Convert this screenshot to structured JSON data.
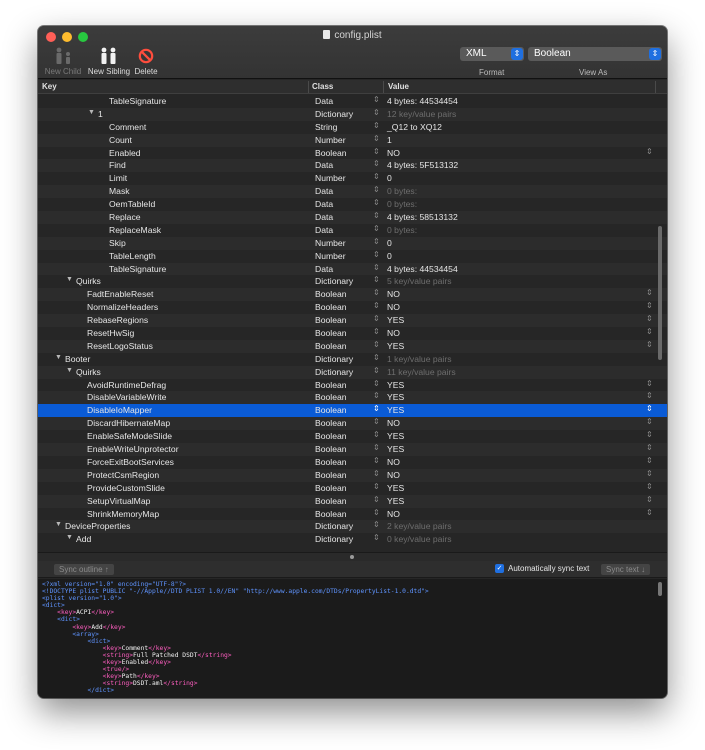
{
  "window": {
    "title": "config.plist"
  },
  "toolbar": {
    "new_child": "New Child",
    "new_sibling": "New Sibling",
    "delete": "Delete",
    "format_value": "XML",
    "format_label": "Format",
    "view_value": "Boolean",
    "view_label": "View As"
  },
  "columns": {
    "key": "Key",
    "class": "Class",
    "value": "Value"
  },
  "rows": [
    {
      "key": "TableSignature",
      "level": 5,
      "tri": "",
      "class": "Data",
      "value": "4 bytes: 44534454",
      "dim": false,
      "step": false,
      "sel": false
    },
    {
      "key": "1",
      "level": 4,
      "tri": "▼",
      "class": "Dictionary",
      "value": "12 key/value pairs",
      "dim": true,
      "step": false,
      "sel": false
    },
    {
      "key": "Comment",
      "level": 5,
      "tri": "",
      "class": "String",
      "value": "_Q12 to XQ12",
      "dim": false,
      "step": false,
      "sel": false
    },
    {
      "key": "Count",
      "level": 5,
      "tri": "",
      "class": "Number",
      "value": "1",
      "dim": false,
      "step": false,
      "sel": false
    },
    {
      "key": "Enabled",
      "level": 5,
      "tri": "",
      "class": "Boolean",
      "value": "NO",
      "dim": false,
      "step": true,
      "sel": false
    },
    {
      "key": "Find",
      "level": 5,
      "tri": "",
      "class": "Data",
      "value": "4 bytes: 5F513132",
      "dim": false,
      "step": false,
      "sel": false
    },
    {
      "key": "Limit",
      "level": 5,
      "tri": "",
      "class": "Number",
      "value": "0",
      "dim": false,
      "step": false,
      "sel": false
    },
    {
      "key": "Mask",
      "level": 5,
      "tri": "",
      "class": "Data",
      "value": "0 bytes:",
      "dim": true,
      "step": false,
      "sel": false
    },
    {
      "key": "OemTableId",
      "level": 5,
      "tri": "",
      "class": "Data",
      "value": "0 bytes:",
      "dim": true,
      "step": false,
      "sel": false
    },
    {
      "key": "Replace",
      "level": 5,
      "tri": "",
      "class": "Data",
      "value": "4 bytes: 58513132",
      "dim": false,
      "step": false,
      "sel": false
    },
    {
      "key": "ReplaceMask",
      "level": 5,
      "tri": "",
      "class": "Data",
      "value": "0 bytes:",
      "dim": true,
      "step": false,
      "sel": false
    },
    {
      "key": "Skip",
      "level": 5,
      "tri": "",
      "class": "Number",
      "value": "0",
      "dim": false,
      "step": false,
      "sel": false
    },
    {
      "key": "TableLength",
      "level": 5,
      "tri": "",
      "class": "Number",
      "value": "0",
      "dim": false,
      "step": false,
      "sel": false
    },
    {
      "key": "TableSignature",
      "level": 5,
      "tri": "",
      "class": "Data",
      "value": "4 bytes: 44534454",
      "dim": false,
      "step": false,
      "sel": false
    },
    {
      "key": "Quirks",
      "level": 2,
      "tri": "▼",
      "class": "Dictionary",
      "value": "5 key/value pairs",
      "dim": true,
      "step": false,
      "sel": false
    },
    {
      "key": "FadtEnableReset",
      "level": 3,
      "tri": "",
      "class": "Boolean",
      "value": "NO",
      "dim": false,
      "step": true,
      "sel": false
    },
    {
      "key": "NormalizeHeaders",
      "level": 3,
      "tri": "",
      "class": "Boolean",
      "value": "NO",
      "dim": false,
      "step": true,
      "sel": false
    },
    {
      "key": "RebaseRegions",
      "level": 3,
      "tri": "",
      "class": "Boolean",
      "value": "YES",
      "dim": false,
      "step": true,
      "sel": false
    },
    {
      "key": "ResetHwSig",
      "level": 3,
      "tri": "",
      "class": "Boolean",
      "value": "NO",
      "dim": false,
      "step": true,
      "sel": false
    },
    {
      "key": "ResetLogoStatus",
      "level": 3,
      "tri": "",
      "class": "Boolean",
      "value": "YES",
      "dim": false,
      "step": true,
      "sel": false
    },
    {
      "key": "Booter",
      "level": 1,
      "tri": "▼",
      "class": "Dictionary",
      "value": "1 key/value pairs",
      "dim": true,
      "step": false,
      "sel": false
    },
    {
      "key": "Quirks",
      "level": 2,
      "tri": "▼",
      "class": "Dictionary",
      "value": "11 key/value pairs",
      "dim": true,
      "step": false,
      "sel": false
    },
    {
      "key": "AvoidRuntimeDefrag",
      "level": 3,
      "tri": "",
      "class": "Boolean",
      "value": "YES",
      "dim": false,
      "step": true,
      "sel": false
    },
    {
      "key": "DisableVariableWrite",
      "level": 3,
      "tri": "",
      "class": "Boolean",
      "value": "YES",
      "dim": false,
      "step": true,
      "sel": false
    },
    {
      "key": "DisableIoMapper",
      "level": 3,
      "tri": "",
      "class": "Boolean",
      "value": "YES",
      "dim": false,
      "step": true,
      "sel": true
    },
    {
      "key": "DiscardHibernateMap",
      "level": 3,
      "tri": "",
      "class": "Boolean",
      "value": "NO",
      "dim": false,
      "step": true,
      "sel": false
    },
    {
      "key": "EnableSafeModeSlide",
      "level": 3,
      "tri": "",
      "class": "Boolean",
      "value": "YES",
      "dim": false,
      "step": true,
      "sel": false
    },
    {
      "key": "EnableWriteUnprotector",
      "level": 3,
      "tri": "",
      "class": "Boolean",
      "value": "YES",
      "dim": false,
      "step": true,
      "sel": false
    },
    {
      "key": "ForceExitBootServices",
      "level": 3,
      "tri": "",
      "class": "Boolean",
      "value": "NO",
      "dim": false,
      "step": true,
      "sel": false
    },
    {
      "key": "ProtectCsmRegion",
      "level": 3,
      "tri": "",
      "class": "Boolean",
      "value": "NO",
      "dim": false,
      "step": true,
      "sel": false
    },
    {
      "key": "ProvideCustomSlide",
      "level": 3,
      "tri": "",
      "class": "Boolean",
      "value": "YES",
      "dim": false,
      "step": true,
      "sel": false
    },
    {
      "key": "SetupVirtualMap",
      "level": 3,
      "tri": "",
      "class": "Boolean",
      "value": "YES",
      "dim": false,
      "step": true,
      "sel": false
    },
    {
      "key": "ShrinkMemoryMap",
      "level": 3,
      "tri": "",
      "class": "Boolean",
      "value": "NO",
      "dim": false,
      "step": true,
      "sel": false
    },
    {
      "key": "DeviceProperties",
      "level": 1,
      "tri": "▼",
      "class": "Dictionary",
      "value": "2 key/value pairs",
      "dim": true,
      "step": false,
      "sel": false
    },
    {
      "key": "Add",
      "level": 2,
      "tri": "▼",
      "class": "Dictionary",
      "value": "0 key/value pairs",
      "dim": true,
      "step": false,
      "sel": false
    }
  ],
  "sync": {
    "outline_button": "Sync outline ↑",
    "auto_label": "Automatically sync text",
    "text_button": "Sync text ↓"
  },
  "xml_lines": [
    [
      {
        "c": "blue",
        "t": "<?xml version=\"1.0\" encoding=\"UTF-8\"?>"
      }
    ],
    [
      {
        "c": "blue",
        "t": "<!DOCTYPE plist PUBLIC \"-//Apple//DTD PLIST 1.0//EN\" \"http://www.apple.com/DTDs/PropertyList-1.0.dtd\">"
      }
    ],
    [
      {
        "c": "blue",
        "t": "<plist version=\"1.0\">"
      }
    ],
    [
      {
        "c": "blue",
        "t": "<dict>"
      }
    ],
    [
      {
        "c": "white",
        "t": "    "
      },
      {
        "c": "pink",
        "t": "<key>"
      },
      {
        "c": "white",
        "t": "ACPI"
      },
      {
        "c": "pink",
        "t": "</key>"
      }
    ],
    [
      {
        "c": "white",
        "t": "    "
      },
      {
        "c": "blue",
        "t": "<dict>"
      }
    ],
    [
      {
        "c": "white",
        "t": "        "
      },
      {
        "c": "pink",
        "t": "<key>"
      },
      {
        "c": "white",
        "t": "Add"
      },
      {
        "c": "pink",
        "t": "</key>"
      }
    ],
    [
      {
        "c": "white",
        "t": "        "
      },
      {
        "c": "blue",
        "t": "<array>"
      }
    ],
    [
      {
        "c": "white",
        "t": "            "
      },
      {
        "c": "blue",
        "t": "<dict>"
      }
    ],
    [
      {
        "c": "white",
        "t": "                "
      },
      {
        "c": "pink",
        "t": "<key>"
      },
      {
        "c": "white",
        "t": "Comment"
      },
      {
        "c": "pink",
        "t": "</key>"
      }
    ],
    [
      {
        "c": "white",
        "t": "                "
      },
      {
        "c": "pink",
        "t": "<string>"
      },
      {
        "c": "white",
        "t": "Full Patched DSDT"
      },
      {
        "c": "pink",
        "t": "</string>"
      }
    ],
    [
      {
        "c": "white",
        "t": "                "
      },
      {
        "c": "pink",
        "t": "<key>"
      },
      {
        "c": "white",
        "t": "Enabled"
      },
      {
        "c": "pink",
        "t": "</key>"
      }
    ],
    [
      {
        "c": "white",
        "t": "                "
      },
      {
        "c": "pink",
        "t": "<true/>"
      }
    ],
    [
      {
        "c": "white",
        "t": "                "
      },
      {
        "c": "pink",
        "t": "<key>"
      },
      {
        "c": "white",
        "t": "Path"
      },
      {
        "c": "pink",
        "t": "</key>"
      }
    ],
    [
      {
        "c": "white",
        "t": "                "
      },
      {
        "c": "pink",
        "t": "<string>"
      },
      {
        "c": "white",
        "t": "DSDT.aml"
      },
      {
        "c": "pink",
        "t": "</string>"
      }
    ],
    [
      {
        "c": "white",
        "t": "            "
      },
      {
        "c": "blue",
        "t": "</dict>"
      }
    ]
  ]
}
